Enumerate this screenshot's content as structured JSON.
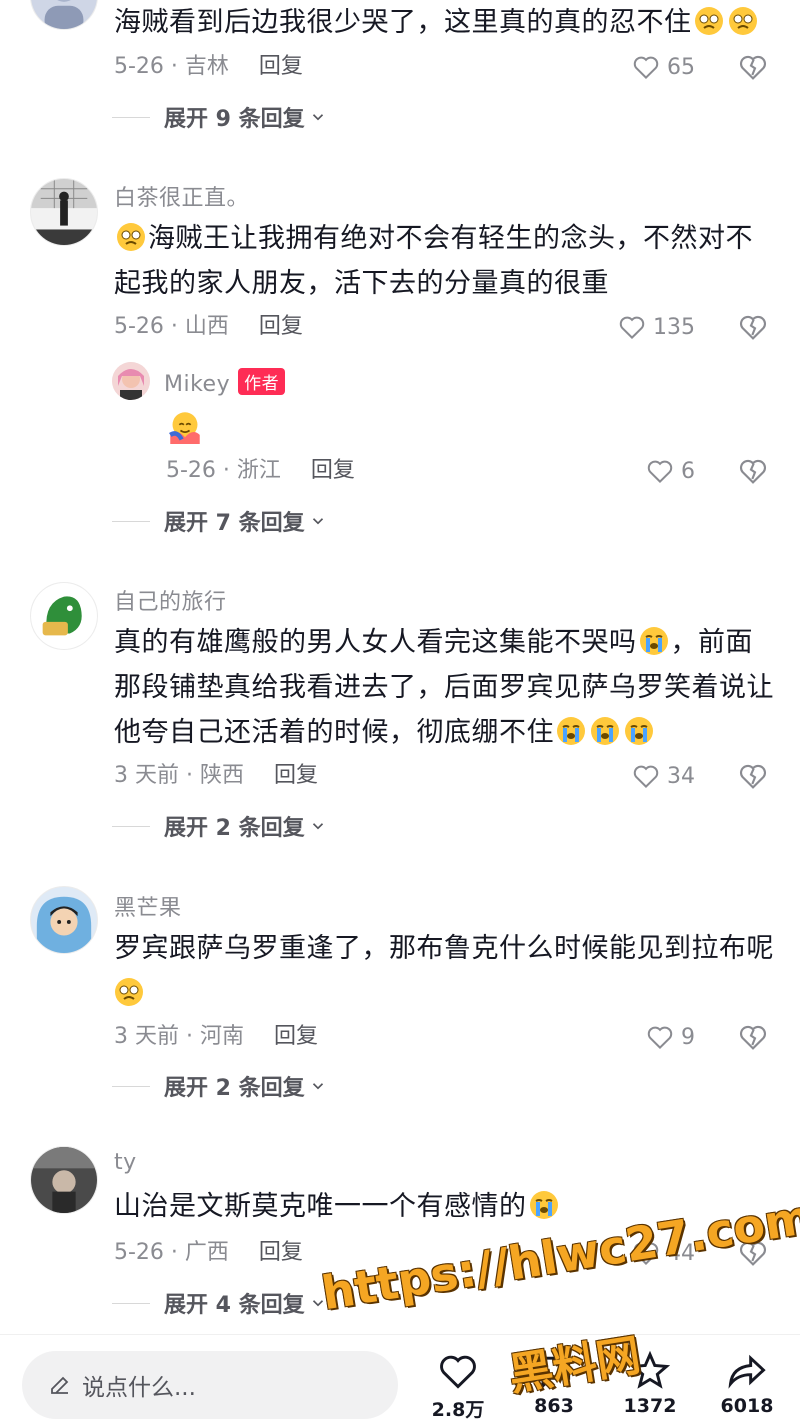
{
  "comments": [
    {
      "username": "",
      "text": "海贼看到后边我很少哭了，这里真的真的忍不住",
      "date_location": "5-26 · 吉林",
      "reply_label": "回复",
      "likes": "65",
      "expand_label": "展开 9 条回复"
    },
    {
      "username": "白茶很正直。",
      "text": "海贼王让我拥有绝对不会有轻生的念头，不然对不起我的家人朋友，活下去的分量真的很重",
      "date_location": "5-26 · 山西",
      "reply_label": "回复",
      "likes": "135",
      "sub_reply": {
        "username": "Mikey",
        "badge": "作者",
        "date_location": "5-26 · 浙江",
        "reply_label": "回复",
        "likes": "6"
      },
      "expand_label": "展开 7 条回复"
    },
    {
      "username": "自己的旅行",
      "text_line1": "真的有雄鹰般的男人女人看完这集能不哭吗",
      "text_line1_end": "，前面",
      "text_line2": "那段铺垫真给我看进去了，后面罗宾见萨乌罗笑着说让",
      "text_line3": "他夸自己还活着的时候，彻底绷不住",
      "date_location": "3 天前 · 陕西",
      "reply_label": "回复",
      "likes": "34",
      "expand_label": "展开 2 条回复"
    },
    {
      "username": "黑芒果",
      "text": "罗宾跟萨乌罗重逢了，那布鲁克什么时候能见到拉布呢",
      "date_location": "3 天前 · 河南",
      "reply_label": "回复",
      "likes": "9",
      "expand_label": "展开 2 条回复"
    },
    {
      "username": "ty",
      "text": "山治是文斯莫克唯一一个有感情的",
      "date_location": "5-26 · 广西",
      "reply_label": "回复",
      "likes": "44",
      "expand_label": "展开 4 条回复"
    }
  ],
  "bottom_bar": {
    "input_placeholder": "说点什么...",
    "like_count": "2.8万",
    "comment_count": "863",
    "favorite_count": "1372",
    "share_count": "6018"
  },
  "watermark": {
    "line1": "https://hlwc27.com",
    "line2": "黑料网"
  },
  "colors": {
    "text": "#161823",
    "secondary": "#8a8b91",
    "author_badge": "#fe2c55",
    "watermark": "#f5a623"
  }
}
